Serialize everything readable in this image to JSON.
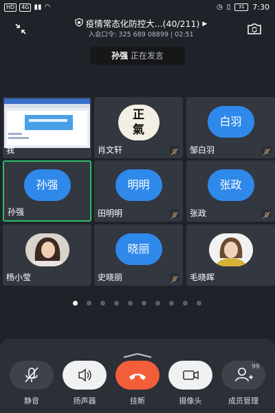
{
  "status_bar": {
    "badges": [
      "HD",
      "4G"
    ],
    "battery": "31",
    "time": "7:30"
  },
  "meeting": {
    "title": "疫情常态化防控大...(40/211)",
    "subtitle": "入会口令: 325 689 08899 | 02:51"
  },
  "speaking": {
    "name": "孙强",
    "status": "正在发言"
  },
  "participants": [
    {
      "name": "我",
      "type": "screen",
      "muted": false
    },
    {
      "name": "肖文轩",
      "type": "logo",
      "logo_text": [
        "正",
        "氣"
      ],
      "muted": true
    },
    {
      "name": "邹白羽",
      "type": "initials",
      "initials": "白羽",
      "muted": true
    },
    {
      "name": "孙强",
      "type": "initials",
      "initials": "孙强",
      "muted": false,
      "active": true
    },
    {
      "name": "田明明",
      "type": "initials",
      "initials": "明明",
      "muted": true
    },
    {
      "name": "张政",
      "type": "initials",
      "initials": "张政",
      "muted": true
    },
    {
      "name": "杨小莹",
      "type": "photo",
      "muted": false
    },
    {
      "name": "史晓丽",
      "type": "initials",
      "initials": "晓丽",
      "muted": true
    },
    {
      "name": "毛晓晖",
      "type": "photo",
      "muted": false
    }
  ],
  "pagination": {
    "pages": 10,
    "current": 1
  },
  "controls": [
    {
      "label": "静音",
      "icon": "mic-muted-icon"
    },
    {
      "label": "扬声器",
      "icon": "speaker-icon"
    },
    {
      "label": "挂断",
      "icon": "hangup-icon"
    },
    {
      "label": "摄像头",
      "icon": "camera-icon"
    },
    {
      "label": "成员管理",
      "icon": "add-member-icon",
      "badge": "99"
    }
  ],
  "colors": {
    "accent": "#2f89ea",
    "hangup": "#f25e3a",
    "active_border": "#2bbf6a",
    "tile": "#333740",
    "bg": "#1f2228"
  }
}
